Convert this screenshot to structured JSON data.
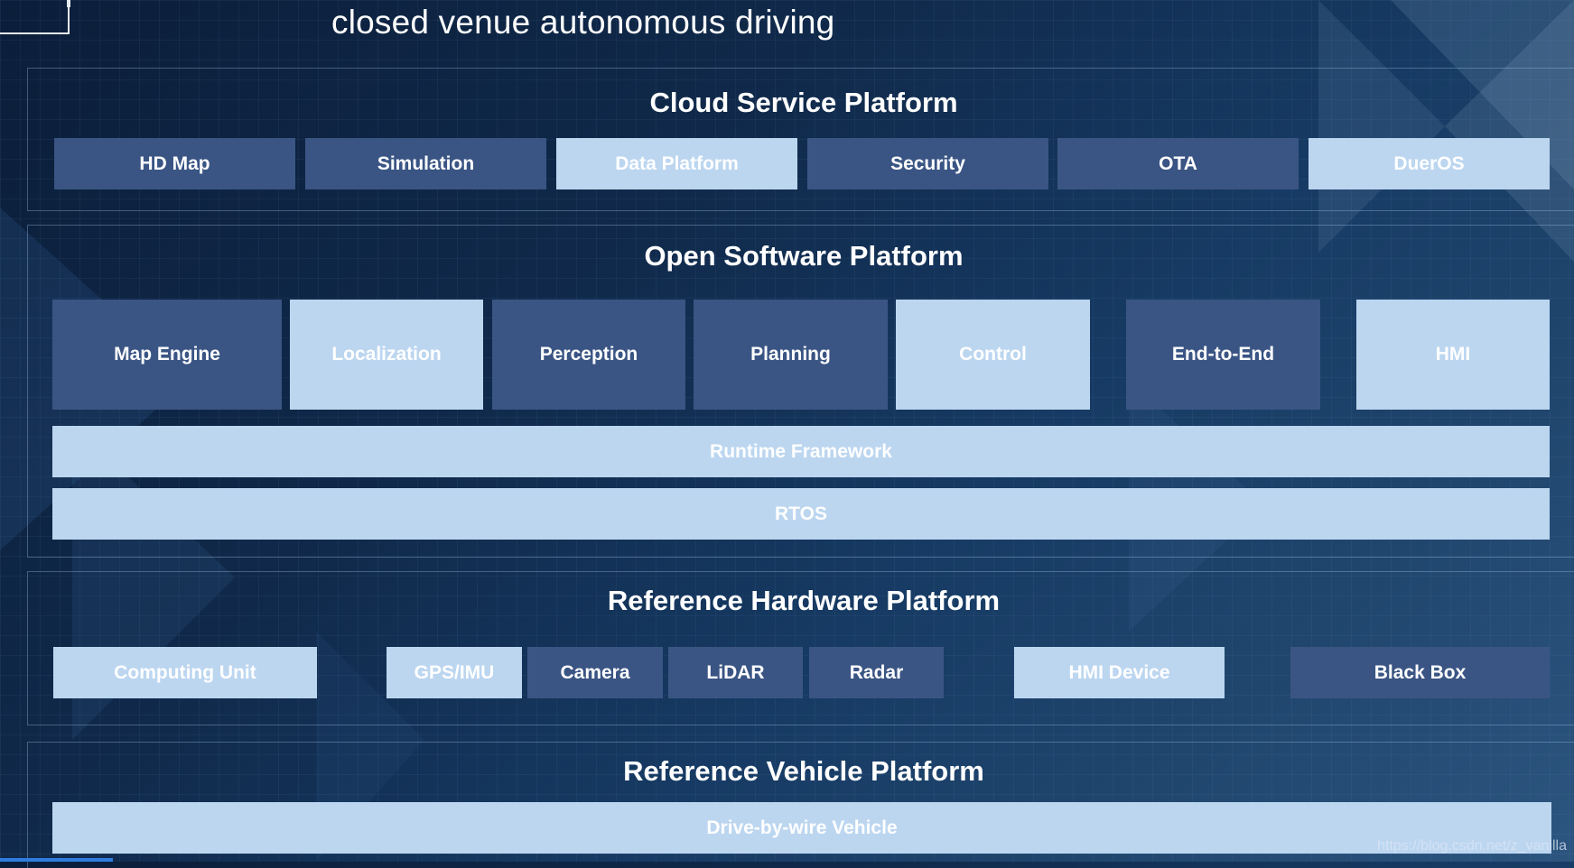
{
  "title": "closed venue autonomous driving",
  "cloud": {
    "title": "Cloud Service Platform",
    "items": [
      "HD Map",
      "Simulation",
      "Data Platform",
      "Security",
      "OTA",
      "DuerOS"
    ]
  },
  "software": {
    "title": "Open Software Platform",
    "modules": [
      "Map Engine",
      "Localization",
      "Perception",
      "Planning",
      "Control",
      "End-to-End",
      "HMI"
    ],
    "runtime": "Runtime Framework",
    "rtos": "RTOS"
  },
  "hardware": {
    "title": "Reference Hardware Platform",
    "items": [
      "Computing Unit",
      "GPS/IMU",
      "Camera",
      "LiDAR",
      "Radar",
      "HMI Device",
      "Black Box"
    ]
  },
  "vehicle": {
    "title": "Reference Vehicle Platform",
    "bar": "Drive-by-wire Vehicle"
  },
  "watermark": "https://blog.csdn.net/z_vanilla",
  "colors": {
    "background": "#10294a",
    "dark_box": "#3a5584",
    "light_box": "#bcd6f0",
    "text": "#ffffff"
  }
}
